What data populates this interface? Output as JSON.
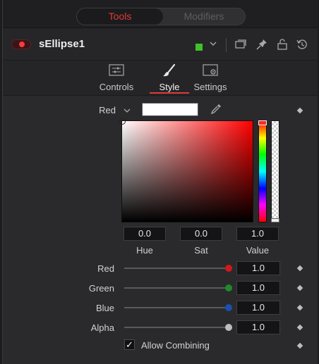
{
  "top_tabs": {
    "tools": "Tools",
    "modifiers": "Modifiers"
  },
  "header": {
    "tool_name": "sEllipse1",
    "tool_color": "#3ec22a"
  },
  "tabs": [
    {
      "label": "Controls",
      "icon": "sliders-icon"
    },
    {
      "label": "Style",
      "icon": "brush-icon",
      "active": true
    },
    {
      "label": "Settings",
      "icon": "settings-icon"
    }
  ],
  "color": {
    "channel_select": "Red",
    "swatch_color": "#ffffff",
    "hsv": {
      "hue": "0.0",
      "sat": "0.0",
      "value": "1.0"
    },
    "hsv_labels": {
      "hue": "Hue",
      "sat": "Sat",
      "value": "Value"
    }
  },
  "channels": [
    {
      "label": "Red",
      "value": "1.0",
      "color": "#d21818",
      "fraction": 1.0
    },
    {
      "label": "Green",
      "value": "1.0",
      "color": "#1e8a2a",
      "fraction": 1.0
    },
    {
      "label": "Blue",
      "value": "1.0",
      "color": "#1a4fb4",
      "fraction": 1.0
    },
    {
      "label": "Alpha",
      "value": "1.0",
      "color": "#bdbdbd",
      "fraction": 1.0
    }
  ],
  "allow_combining": {
    "label": "Allow Combining",
    "checked": true
  }
}
